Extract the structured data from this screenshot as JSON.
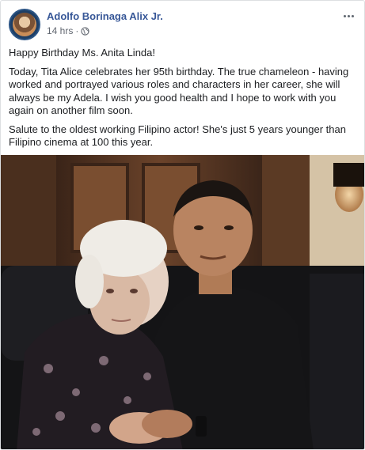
{
  "post": {
    "author": "Adolfo Borinaga Alix Jr.",
    "timestamp": "14 hrs",
    "separator": "·",
    "privacy_icon": "globe-icon",
    "more_icon": "more-options-icon",
    "paragraphs": [
      "Happy Birthday Ms. Anita Linda!",
      "Today, Tita Alice celebrates her 95th birthday. The true chameleon - having worked and portrayed various roles and characters in her career, she will always be my Adela. I wish you good health and I hope to work with you again on another film soon.",
      "Salute to the oldest working Filipino actor! She's just 5 years younger than Filipino cinema at 100 this year."
    ]
  },
  "colors": {
    "author": "#385898",
    "meta": "#616770",
    "text": "#1c1e21"
  }
}
